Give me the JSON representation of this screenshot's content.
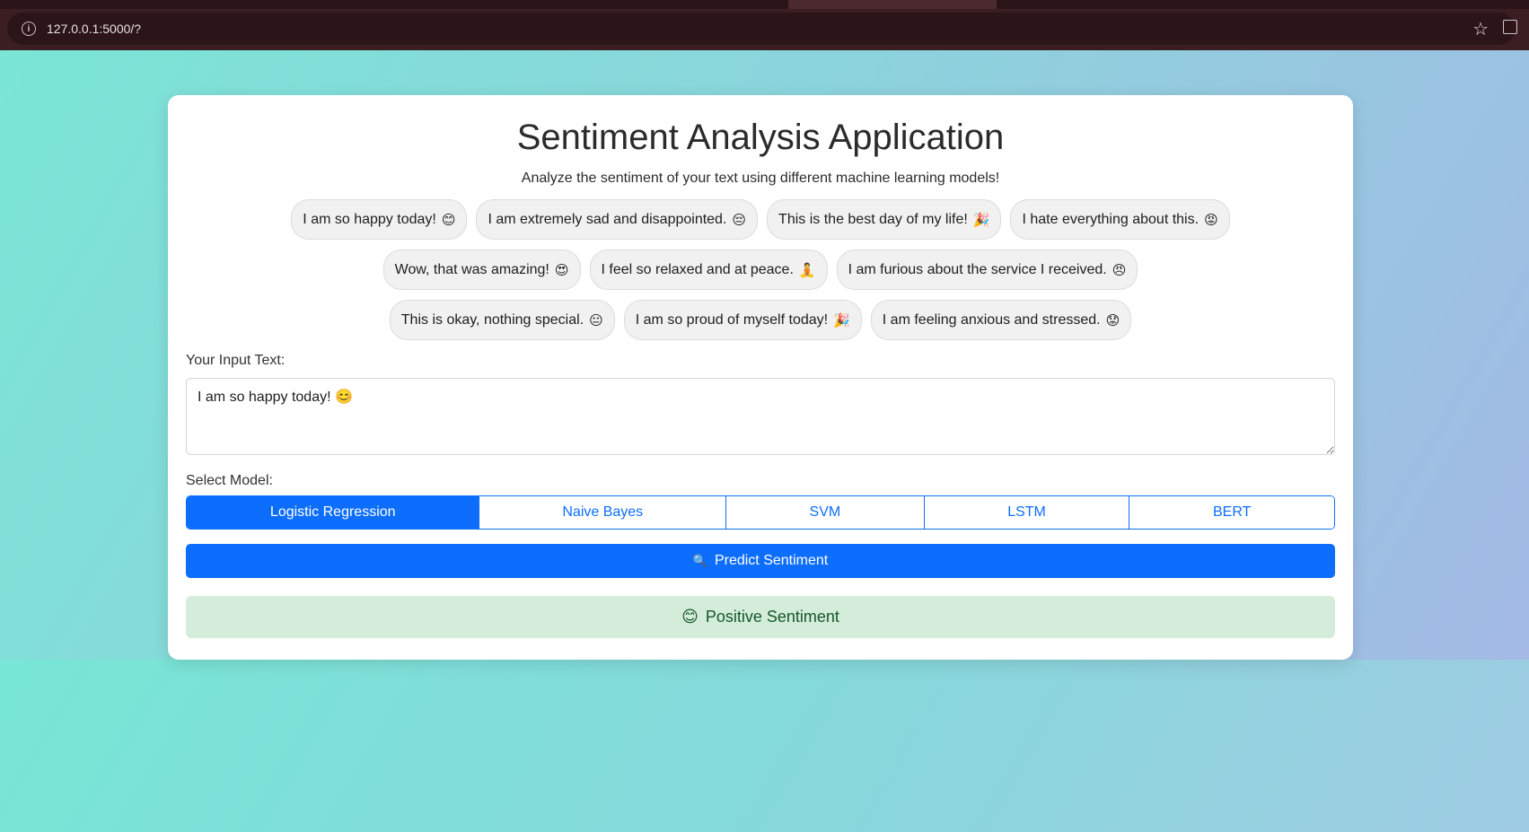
{
  "browser": {
    "url": "127.0.0.1:5000/?"
  },
  "header": {
    "title": "Sentiment Analysis Application",
    "subtitle": "Analyze the sentiment of your text using different machine learning models!"
  },
  "examples": [
    {
      "text": "I am so happy today!",
      "emoji": "😊"
    },
    {
      "text": "I am extremely sad and disappointed.",
      "emoji": "😔"
    },
    {
      "text": "This is the best day of my life!",
      "emoji": "🎉"
    },
    {
      "text": "I hate everything about this.",
      "emoji": "😡"
    },
    {
      "text": "Wow, that was amazing!",
      "emoji": "😍"
    },
    {
      "text": "I feel so relaxed and at peace.",
      "emoji": "🧘"
    },
    {
      "text": "I am furious about the service I received.",
      "emoji": "😠"
    },
    {
      "text": "This is okay, nothing special.",
      "emoji": "😐"
    },
    {
      "text": "I am so proud of myself today!",
      "emoji": "🎉"
    },
    {
      "text": "I am feeling anxious and stressed.",
      "emoji": "😟"
    }
  ],
  "input": {
    "label": "Your Input Text:",
    "value": "I am so happy today! 😊"
  },
  "models": {
    "label": "Select Model:",
    "options": [
      "Logistic Regression",
      "Naive Bayes",
      "SVM",
      "LSTM",
      "BERT"
    ],
    "selected": "Logistic Regression"
  },
  "predict": {
    "icon": "🔍",
    "label": "Predict Sentiment"
  },
  "result": {
    "emoji": "😊",
    "label": "Positive Sentiment"
  },
  "colors": {
    "primary": "#0d6efd",
    "success_bg": "#d4eddb",
    "success_text": "#15572a"
  }
}
